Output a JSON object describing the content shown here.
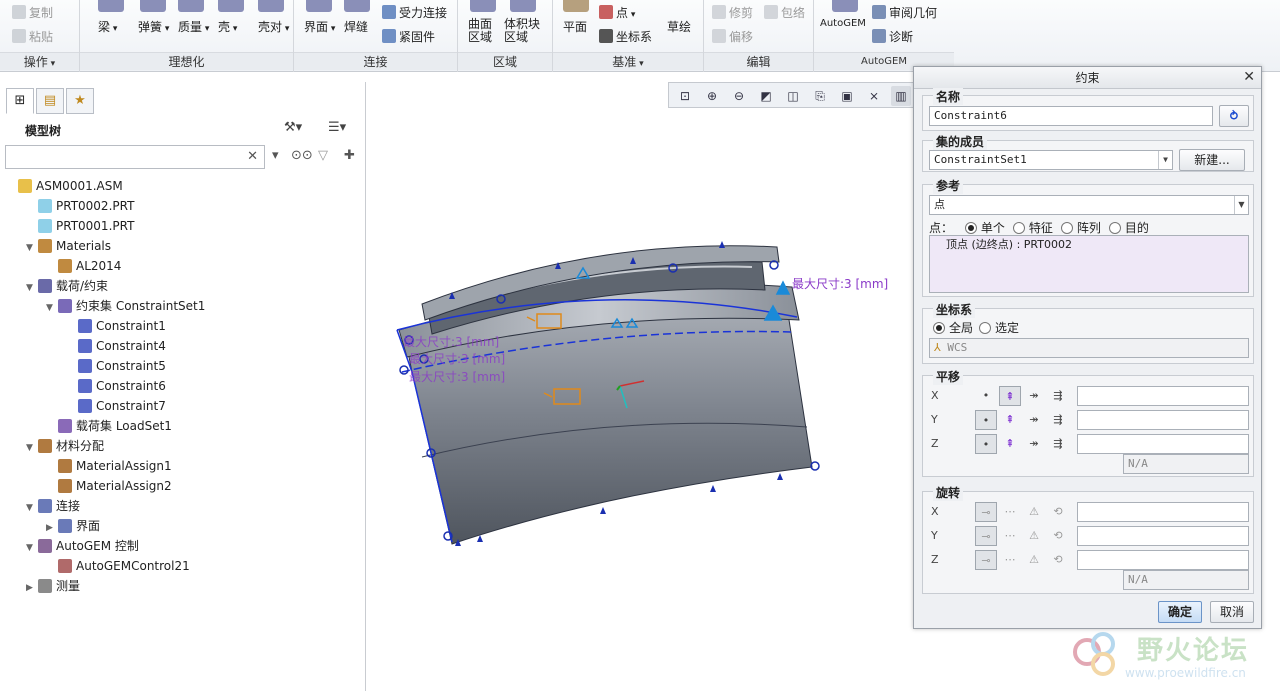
{
  "ribbon": {
    "groups": [
      {
        "label": "操作",
        "items": [
          "复制",
          "粘贴"
        ]
      },
      {
        "label": "理想化",
        "items": [
          "梁",
          "弹簧",
          "质量",
          "壳",
          "壳对"
        ]
      },
      {
        "label": "连接",
        "items": [
          "界面",
          "焊缝",
          "受力连接",
          "紧固件"
        ]
      },
      {
        "label": "区域",
        "items": [
          "曲面区域",
          "体积块区域"
        ]
      },
      {
        "label": "基准",
        "items": [
          "平面",
          "点",
          "坐标系",
          "草绘"
        ]
      },
      {
        "label": "编辑",
        "items": [
          "修剪",
          "包络",
          "偏移"
        ]
      },
      {
        "label": "AutoGEM",
        "items": [
          "AutoGEM",
          "审阅几何",
          "诊断"
        ]
      }
    ]
  },
  "left_panel": {
    "title": "模型树",
    "search_value": "",
    "tree": [
      {
        "label": "ASM0001.ASM",
        "level": 0,
        "expander": "",
        "icon": "assembly-icon"
      },
      {
        "label": "PRT0002.PRT",
        "level": 1,
        "expander": "",
        "icon": "part-icon"
      },
      {
        "label": "PRT0001.PRT",
        "level": 1,
        "expander": "",
        "icon": "part-icon"
      },
      {
        "label": "Materials",
        "level": 1,
        "expander": "▼",
        "icon": "materials-icon"
      },
      {
        "label": "AL2014",
        "level": 2,
        "expander": "",
        "icon": "material-icon"
      },
      {
        "label": "载荷/约束",
        "level": 1,
        "expander": "▼",
        "icon": "loads-icon"
      },
      {
        "label": "约束集 ConstraintSet1",
        "level": 2,
        "expander": "▼",
        "icon": "constraint-set-icon"
      },
      {
        "label": "Constraint1",
        "level": 3,
        "expander": "",
        "icon": "constraint-icon"
      },
      {
        "label": "Constraint4",
        "level": 3,
        "expander": "",
        "icon": "constraint-icon"
      },
      {
        "label": "Constraint5",
        "level": 3,
        "expander": "",
        "icon": "constraint-icon"
      },
      {
        "label": "Constraint6",
        "level": 3,
        "expander": "",
        "icon": "constraint-icon"
      },
      {
        "label": "Constraint7",
        "level": 3,
        "expander": "",
        "icon": "constraint-icon"
      },
      {
        "label": "载荷集 LoadSet1",
        "level": 2,
        "expander": "",
        "icon": "load-set-icon"
      },
      {
        "label": "材料分配",
        "level": 1,
        "expander": "▼",
        "icon": "material-assign-group-icon"
      },
      {
        "label": "MaterialAssign1",
        "level": 2,
        "expander": "",
        "icon": "material-assign-icon"
      },
      {
        "label": "MaterialAssign2",
        "level": 2,
        "expander": "",
        "icon": "material-assign-icon"
      },
      {
        "label": "连接",
        "level": 1,
        "expander": "▼",
        "icon": "connection-icon"
      },
      {
        "label": "界面",
        "level": 2,
        "expander": "▶",
        "icon": "interface-icon"
      },
      {
        "label": "AutoGEM 控制",
        "level": 1,
        "expander": "▼",
        "icon": "autogem-icon"
      },
      {
        "label": "AutoGEMControl21",
        "level": 2,
        "expander": "",
        "icon": "autogem-control-icon"
      },
      {
        "label": "测量",
        "level": 1,
        "expander": "▶",
        "icon": "measure-icon"
      }
    ]
  },
  "viewport": {
    "labels": [
      "最大尺寸:3 [mm]",
      "最大尺寸:3 [mm]",
      "最大尺寸:3 [mm]",
      "最大尺寸:3 [mm]"
    ]
  },
  "dialog": {
    "title": "约束",
    "name_label": "名称",
    "name_value": "Constraint6",
    "member_label": "集的成员",
    "member_value": "ConstraintSet1",
    "new_button": "新建...",
    "ref_label": "参考",
    "ref_value": "点",
    "point_label": "点：",
    "point_options": [
      "单个",
      "特征",
      "阵列",
      "目的"
    ],
    "point_selected": "单个",
    "ref_item": "顶点 (边终点) : PRT0002",
    "cs_label": "坐标系",
    "cs_options": [
      "全局",
      "选定"
    ],
    "cs_selected": "全局",
    "cs_value": "WCS",
    "trans_label": "平移",
    "rot_label": "旋转",
    "axes": [
      "X",
      "Y",
      "Z"
    ],
    "na": "N/A",
    "ok": "确定",
    "cancel": "取消"
  },
  "watermark": {
    "title": "野火论坛",
    "url": "www.proewildfire.cn"
  }
}
